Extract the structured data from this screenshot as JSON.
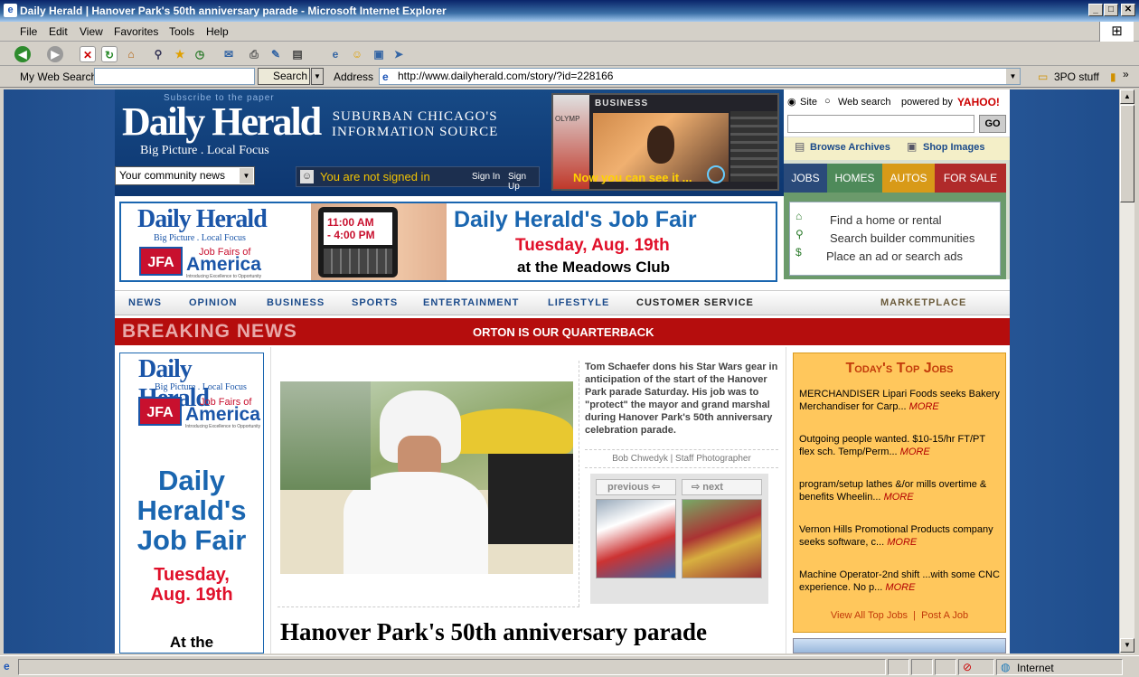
{
  "window": {
    "title": "Daily Herald | Hanover Park's 50th anniversary parade - Microsoft Internet Explorer",
    "min_label": "_",
    "max_label": "□",
    "close_label": "✕"
  },
  "menu": {
    "file": "File",
    "edit": "Edit",
    "view": "View",
    "favorites": "Favorites",
    "tools": "Tools",
    "help": "Help"
  },
  "addressbar": {
    "my_web_search_label": "My Web Search",
    "search_button": "Search",
    "address_label": "Address",
    "url": "http://www.dailyherald.com/story/?id=228166",
    "links_label": "3PO stuff"
  },
  "header": {
    "subscribe": "Subscribe to the paper",
    "logo": "Daily Herald",
    "tagline": "Big Picture . Local Focus",
    "suburban_line1": "SUBURBAN CHICAGO'S",
    "suburban_line2": "INFORMATION SOURCE",
    "community_select": "Your community news",
    "not_signed_in": "You are not signed in",
    "sign_in": "Sign In",
    "sign_up": "Sign Up",
    "business_label": "BUSINESS",
    "video_text": "Now you can see it ...",
    "olymp": "OLYMP"
  },
  "search": {
    "site_label": "Site",
    "web_label": "Web search",
    "powered_by": "powered by",
    "yahoo": "YAHOO!",
    "go": "GO",
    "browse_archives": "Browse Archives",
    "shop_images": "Shop Images"
  },
  "tabs": {
    "jobs": "JOBS",
    "homes": "HOMES",
    "autos": "AUTOS",
    "for_sale": "FOR SALE"
  },
  "homes_links": [
    "Find a home or rental",
    "Search builder communities",
    "Place an ad or search ads"
  ],
  "job_banner": {
    "logo": "Daily Herald",
    "tagline": "Big Picture . Local Focus",
    "jfa": "JFA",
    "jobfairs": "Job Fairs of",
    "america": "America",
    "jfa_sub": "Introducing Excellence to Opportunity",
    "time1": "11:00 AM",
    "time2": "- 4:00 PM",
    "title": "Daily Herald's Job Fair",
    "date": "Tuesday, Aug. 19th",
    "venue": "at the Meadows Club"
  },
  "nav": {
    "news": "NEWS",
    "opinion": "OPINION",
    "business": "BUSINESS",
    "sports": "SPORTS",
    "entertainment": "ENTERTAINMENT",
    "lifestyle": "LIFESTYLE",
    "customer_service": "CUSTOMER SERVICE",
    "marketplace": "MARKETPLACE"
  },
  "breaking": {
    "label": "BREAKING NEWS",
    "headline": "ORTON IS OUR QUARTERBACK"
  },
  "left_ad": {
    "logo": "Daily Herald",
    "tagline": "Big Picture . Local Focus",
    "jfa": "JFA",
    "jobfairs": "Job Fairs of",
    "america": "America",
    "jfa_sub": "Introducing Excellence to Opportunity",
    "line1": "Daily",
    "line2": "Herald's",
    "line3": "Job Fair",
    "date1": "Tuesday,",
    "date2": "Aug. 19th",
    "at": "At the"
  },
  "story": {
    "caption": "Tom Schaefer dons his Star Wars gear in anticipation of the start of the Hanover Park parade Saturday. His job was to \"protect\" the mayor and grand marshal during Hanover Park's 50th anniversary celebration parade.",
    "credit": "Bob Chwedyk | Staff Photographer",
    "previous": "previous",
    "next": "next",
    "headline": "Hanover Park's 50th anniversary parade"
  },
  "top_jobs": {
    "title": "Today's Top Jobs",
    "items": [
      {
        "text": "MERCHANDISER Lipari Foods seeks Bakery Merchandiser for Carp...",
        "more": "MORE"
      },
      {
        "text": "Outgoing people wanted. $10-15/hr FT/PT flex sch. Temp/Perm...",
        "more": "MORE"
      },
      {
        "text": "program/setup lathes &/or mills overtime & benefits Wheelin...",
        "more": "MORE"
      },
      {
        "text": "Vernon Hills Promotional Products company seeks software, c...",
        "more": "MORE"
      },
      {
        "text": "Machine Operator-2nd shift ...with some CNC experience. No p...",
        "more": "MORE"
      }
    ],
    "view_all": "View All Top Jobs",
    "post": "Post A Job"
  },
  "status": {
    "zone": "Internet"
  },
  "colors": {
    "brand_blue": "#0d3670",
    "breaking_red": "#b50d0d",
    "jobs_orange": "#ffc75c"
  }
}
